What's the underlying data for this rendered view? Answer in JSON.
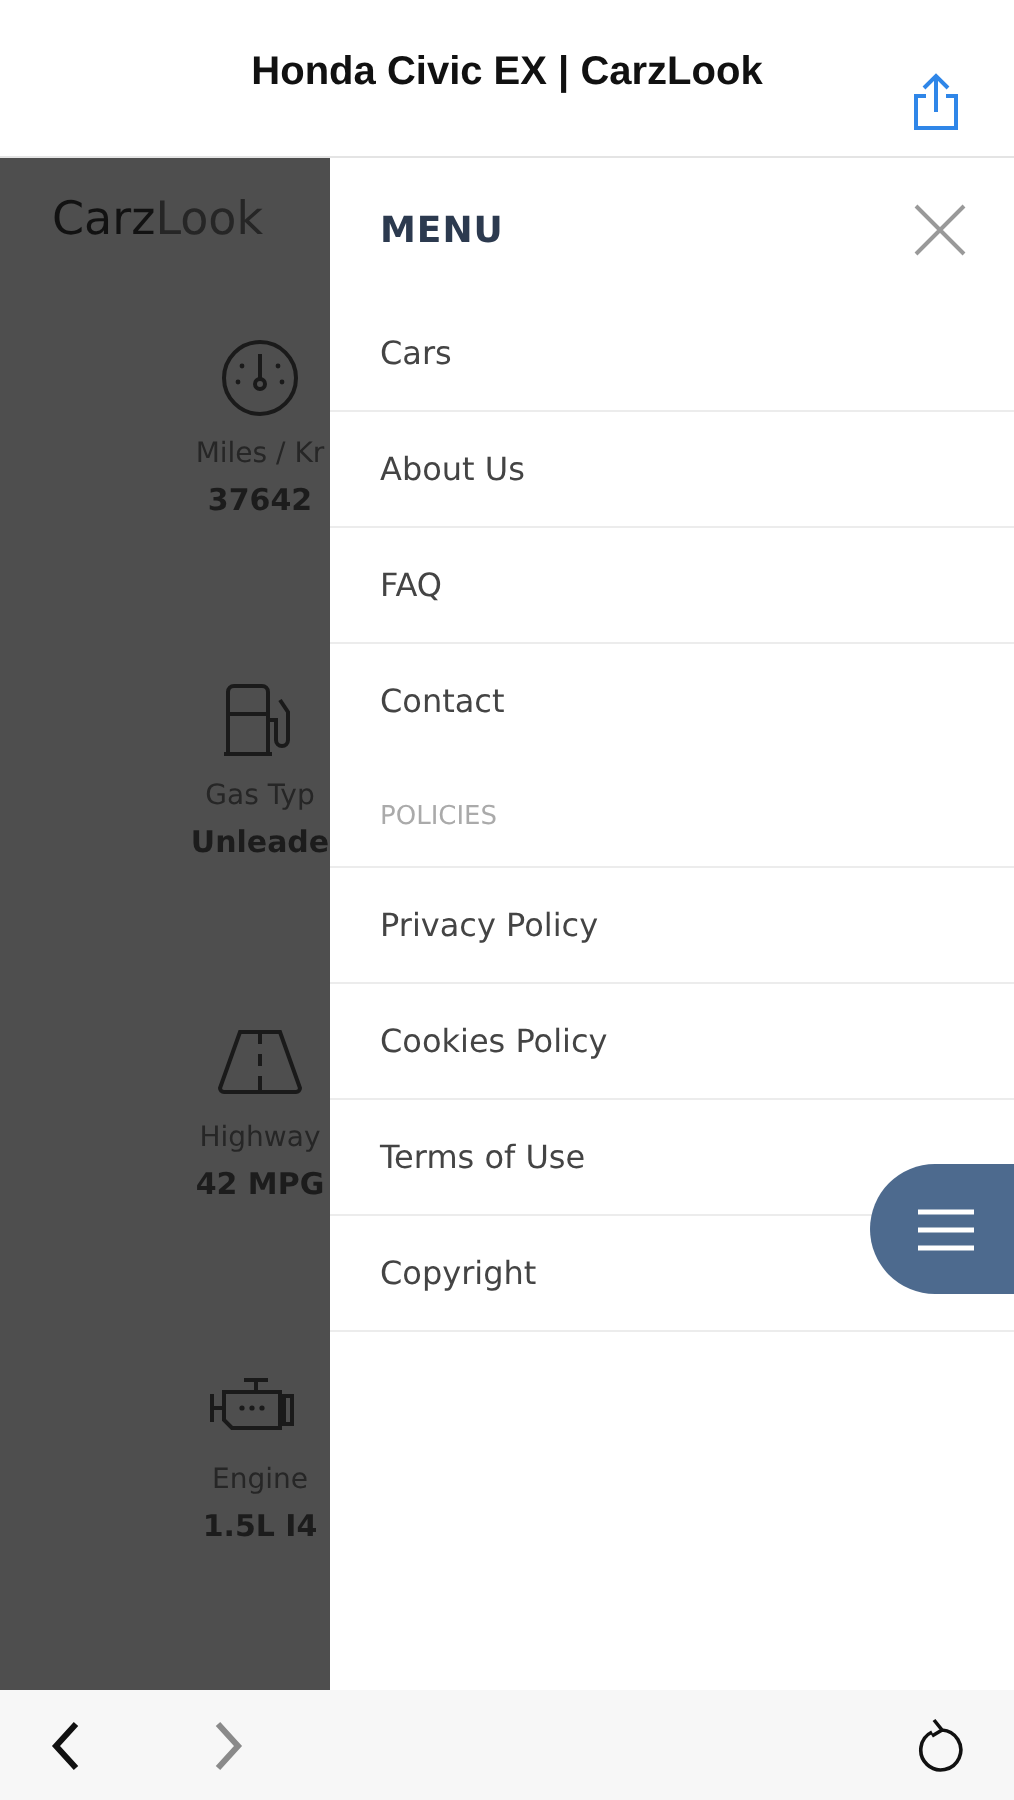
{
  "browser": {
    "title": "Honda Civic EX | CarzLook",
    "back": {
      "disabled": false
    },
    "forward": {
      "disabled": true
    }
  },
  "page": {
    "logo": {
      "part_1": "Carz",
      "part_2": "Look"
    },
    "specs": [
      {
        "kind": "gauge",
        "label": "Miles / Kr",
        "value": "37642"
      },
      {
        "kind": "fuel",
        "label": "Gas Typ",
        "value": "Unleade"
      },
      {
        "kind": "road",
        "label": "Highway",
        "value": "42 MPG"
      },
      {
        "kind": "engine",
        "label": "Engine",
        "value": "1.5L I4"
      }
    ]
  },
  "menu": {
    "title": "MENU",
    "items": [
      {
        "label": "Cars"
      },
      {
        "label": "About Us"
      },
      {
        "label": "FAQ"
      },
      {
        "label": "Contact"
      }
    ],
    "section": "POLICIES",
    "policy_items": [
      {
        "label": "Privacy Policy"
      },
      {
        "label": "Cookies Policy"
      },
      {
        "label": "Terms of Use"
      },
      {
        "label": "Copyright"
      }
    ]
  }
}
